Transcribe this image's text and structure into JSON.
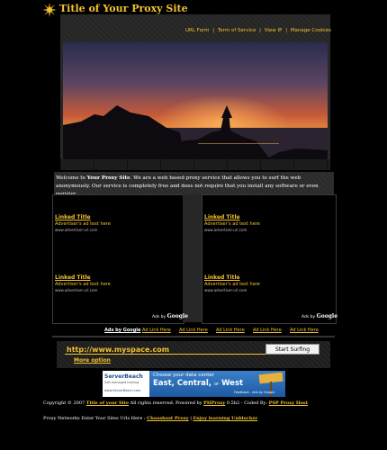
{
  "header": {
    "title": "Title of Your Proxy Site",
    "logo_icon": "sun-star-icon"
  },
  "nav": {
    "items": [
      "URL Form",
      "Term of Service",
      "View IP",
      "Manage Cookies"
    ],
    "separator": "|"
  },
  "welcome": {
    "prefix": "Welcome to ",
    "site_name": "Your Proxy Site",
    "text": ". We are a web based proxy service that allows you to surf the web anonymously. Our service is completely free and does not require that you install any software or even register."
  },
  "ads": {
    "left": [
      {
        "title": "Linked Title",
        "text": "Advertiser's ad text here",
        "url": "www.advertiser-url.com"
      },
      {
        "title": "Linked Title",
        "text": "Advertiser's ad text here",
        "url": "www.advertiser-url.com"
      }
    ],
    "right": [
      {
        "title": "Linked Title",
        "text": "Advertiser's ad text here",
        "url": "www.advertiser-url.com"
      },
      {
        "title": "Linked Title",
        "text": "Advertiser's ad text here",
        "url": "www.advertiser-url.com"
      }
    ],
    "ads_by_label": "Ads by",
    "ads_by_brand": "Google"
  },
  "link_bar": {
    "ads_label": "Ads by Google",
    "links": [
      "Ad Link Here",
      "Ad Link Here",
      "Ad Link Here",
      "Ad Link Here",
      "Ad Link Here"
    ]
  },
  "form": {
    "url_value": "http://www.myspace.com",
    "submit_label": "Start Surfing",
    "more_option": "More option"
  },
  "banner": {
    "brand": "ServerBeach",
    "tagline": "Self-managed hosting",
    "headline": "Choose your data center",
    "locations": "East, Central,",
    "or": "or",
    "west": "West",
    "url": "www.ServerBeach.com",
    "feedback": "Feedback - Ads by Google"
  },
  "footer": {
    "copyright_prefix": "Copyright © 2007 ",
    "site_link": "Title of your Site",
    "copyright_mid": " All rights reserved. Powered by ",
    "phproxy": "PHProxy",
    "version": " 0.5b2 - Coded By: ",
    "coder": "PSP Proxy Host",
    "networks_text": "Proxy Networks Enter Your Sites Urls Here : ",
    "link1": "Chaoshost Proxy",
    "sep": " | ",
    "link2": "Enjoy learning Unblocker"
  },
  "colors": {
    "accent": "#f2c230",
    "background": "#000000",
    "panel": "#262626"
  }
}
